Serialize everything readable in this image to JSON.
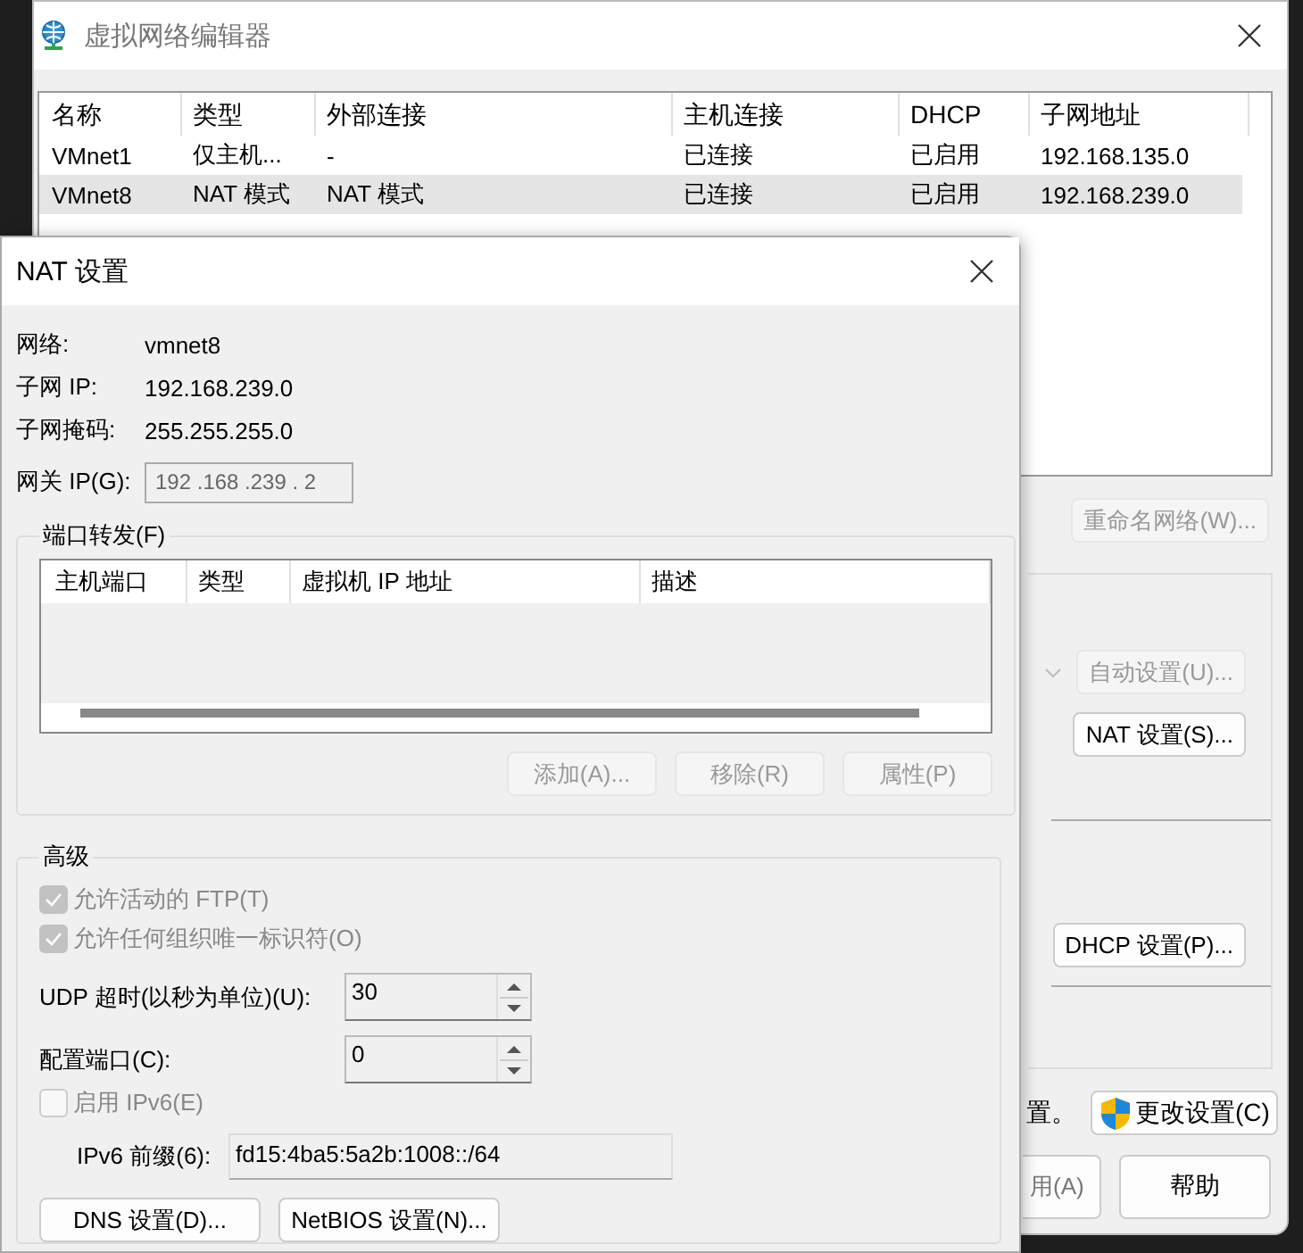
{
  "main_window": {
    "title": "虚拟网络编辑器",
    "table": {
      "columns": [
        "名称",
        "类型",
        "外部连接",
        "主机连接",
        "DHCP",
        "子网地址"
      ],
      "rows": [
        {
          "cells": [
            "VMnet1",
            "仅主机...",
            "-",
            "已连接",
            "已启用",
            "192.168.135.0"
          ],
          "selected": false
        },
        {
          "cells": [
            "VMnet8",
            "NAT 模式",
            "NAT 模式",
            "已连接",
            "已启用",
            "192.168.239.0"
          ],
          "selected": true
        }
      ]
    },
    "rename_button": {
      "label": "重命名网络(W)...",
      "disabled": true
    },
    "auto_button": {
      "label": "自动设置(U)...",
      "disabled": true
    },
    "nat_button": {
      "label": "NAT 设置(S)...",
      "disabled": false
    },
    "dhcp_button": {
      "label": "DHCP 设置(P)...",
      "disabled": false
    },
    "note_fragment": "置。",
    "change_settings_button": {
      "label": "更改设置(C)"
    },
    "apply_button_fragment": {
      "label": "用(A)"
    },
    "help_button": {
      "label": "帮助"
    }
  },
  "nat_dialog": {
    "title": "NAT 设置",
    "info": [
      {
        "label": "网络:",
        "value": "vmnet8"
      },
      {
        "label": "子网 IP:",
        "value": "192.168.239.0"
      },
      {
        "label": "子网掩码:",
        "value": "255.255.255.0"
      }
    ],
    "gateway": {
      "label": "网关 IP(G):",
      "value": "192 .168 .239 . 2",
      "disabled": true
    },
    "port_forwarding": {
      "title": "端口转发(F)",
      "columns": [
        "主机端口",
        "类型",
        "虚拟机 IP 地址",
        "描述"
      ],
      "buttons": [
        {
          "label": "添加(A)...",
          "disabled": true
        },
        {
          "label": "移除(R)",
          "disabled": true
        },
        {
          "label": "属性(P)",
          "disabled": true
        }
      ]
    },
    "advanced": {
      "title": "高级",
      "checkboxes": [
        {
          "label": "允许活动的 FTP(T)",
          "checked": true,
          "disabled": true
        },
        {
          "label": "允许任何组织唯一标识符(O)",
          "checked": true,
          "disabled": true
        }
      ],
      "udp_timeout": {
        "label": "UDP 超时(以秒为单位)(U):",
        "value": "30"
      },
      "config_port": {
        "label": "配置端口(C):",
        "value": "0"
      },
      "ipv6_checkbox": {
        "label": "启用 IPv6(E)",
        "checked": false,
        "disabled": true
      },
      "ipv6_prefix": {
        "label": "IPv6 前缀(6):",
        "value": "fd15:4ba5:5a2b:1008::/64"
      }
    },
    "buttons": [
      {
        "label": "DNS 设置(D)..."
      },
      {
        "label": "NetBIOS 设置(N)..."
      }
    ]
  }
}
